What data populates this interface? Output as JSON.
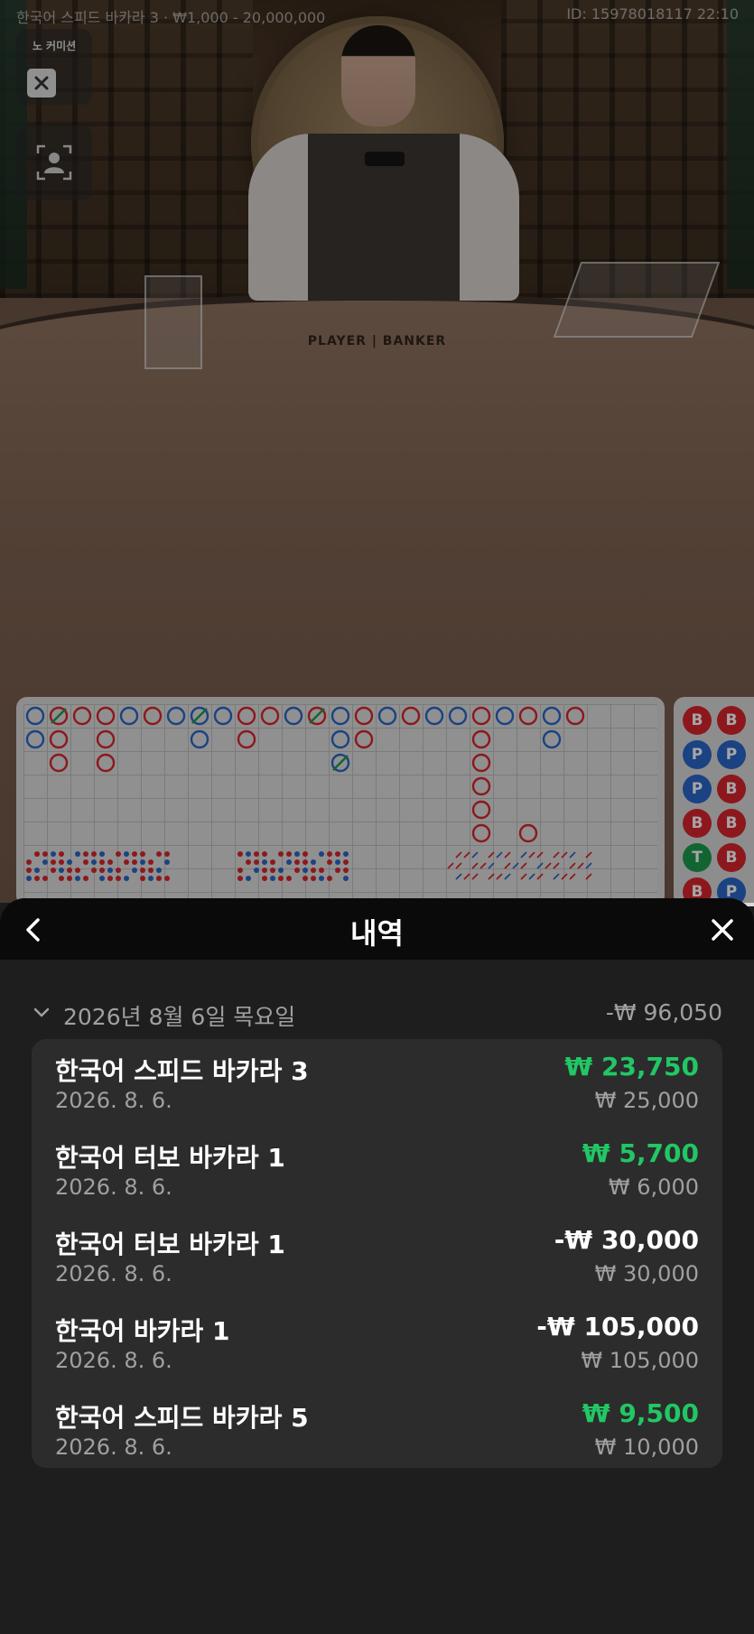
{
  "status_bar": {
    "game_info": "한국어 스피드 바카라 3 · ₩1,000 - 20,000,000",
    "id_time": "ID: 15978018117 22:10"
  },
  "controls": {
    "no_commission_label": "노 커미션"
  },
  "table": {
    "felt_text": "PLAYER | BANKER"
  },
  "roadmap": {
    "colors": {
      "banker": "#d7262d",
      "player": "#2a66c8",
      "tie": "#1c9b4c"
    },
    "side_chips": [
      [
        "B",
        "B"
      ],
      [
        "P",
        "P"
      ],
      [
        "P",
        "B"
      ],
      [
        "B",
        "B"
      ],
      [
        "T",
        "B"
      ],
      [
        "B",
        "P"
      ]
    ]
  },
  "history": {
    "title": "내역",
    "date_group": {
      "label": "2026년 8월 6일 목요일",
      "total": "-₩ 96,050"
    },
    "rows": [
      {
        "name": "한국어 스피드 바카라 3",
        "date": "2026. 8. 6.",
        "result": "₩ 23,750",
        "result_type": "win",
        "bet": "₩ 25,000"
      },
      {
        "name": "한국어 터보 바카라 1",
        "date": "2026. 8. 6.",
        "result": "₩ 5,700",
        "result_type": "win",
        "bet": "₩ 6,000"
      },
      {
        "name": "한국어 터보 바카라 1",
        "date": "2026. 8. 6.",
        "result": "-₩ 30,000",
        "result_type": "loss",
        "bet": "₩ 30,000"
      },
      {
        "name": "한국어 바카라 1",
        "date": "2026. 8. 6.",
        "result": "-₩ 105,000",
        "result_type": "loss",
        "bet": "₩ 105,000"
      },
      {
        "name": "한국어 스피드 바카라 5",
        "date": "2026. 8. 6.",
        "result": "₩ 9,500",
        "result_type": "win",
        "bet": "₩ 10,000"
      }
    ]
  }
}
